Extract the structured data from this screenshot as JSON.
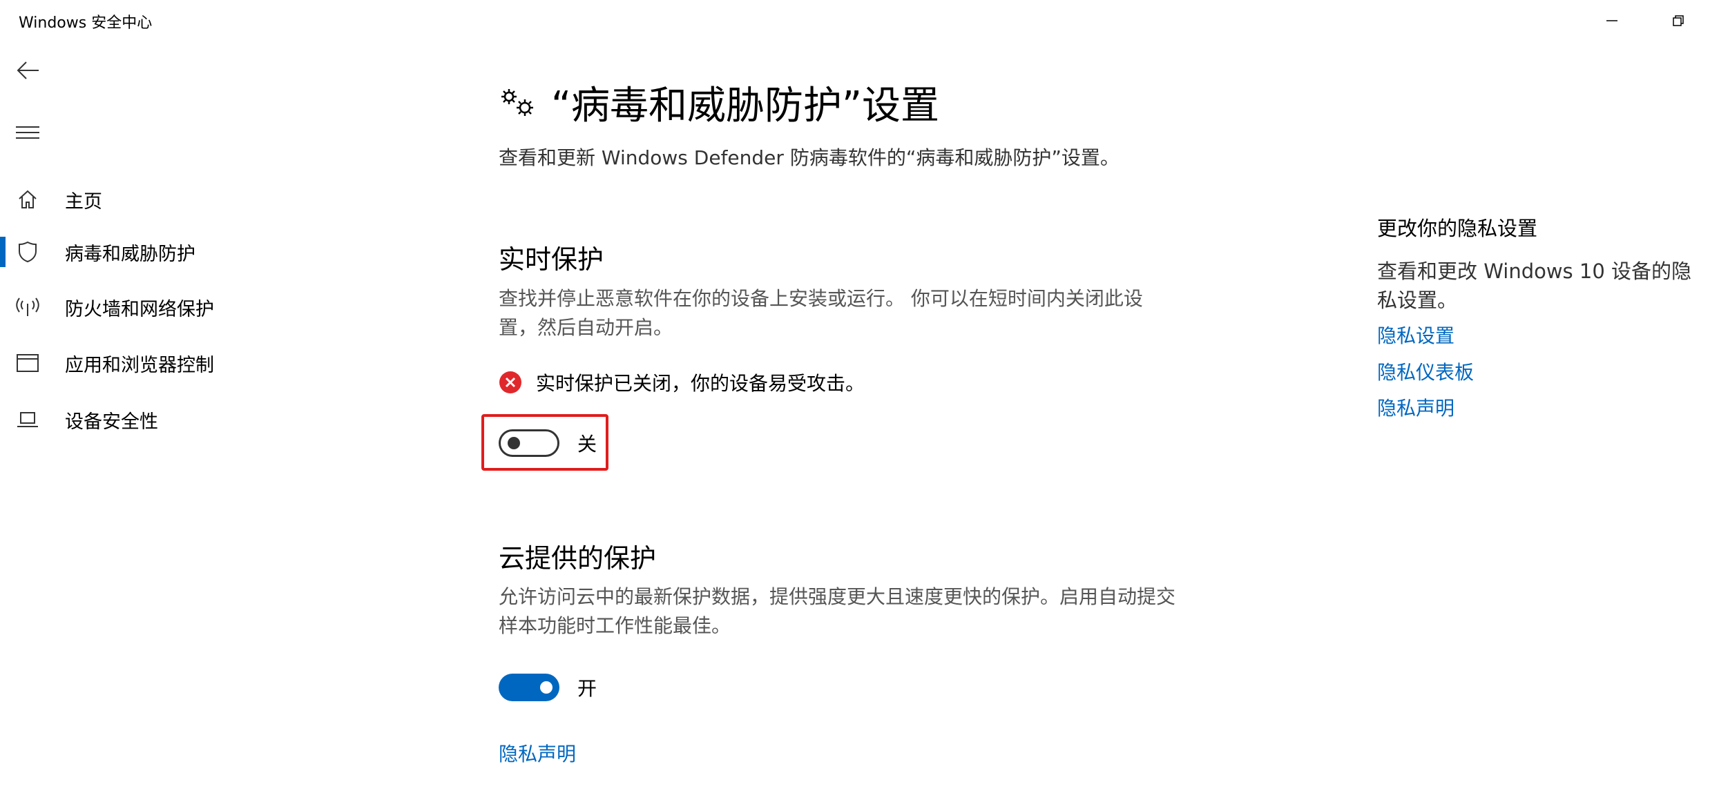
{
  "window": {
    "title": "Windows 安全中心"
  },
  "nav": {
    "items": [
      {
        "label": "主页",
        "icon": "home-icon"
      },
      {
        "label": "病毒和威胁防护",
        "icon": "shield-icon",
        "selected": true
      },
      {
        "label": "防火墙和网络保护",
        "icon": "wireless-antenna-icon"
      },
      {
        "label": "应用和浏览器控制",
        "icon": "app-window-icon"
      },
      {
        "label": "设备安全性",
        "icon": "laptop-icon"
      }
    ]
  },
  "header": {
    "title": "“病毒和威胁防护”设置",
    "description": "查看和更新 Windows Defender 防病毒软件的“病毒和威胁防护”设置。"
  },
  "realtime": {
    "title": "实时保护",
    "description": "查找并停止恶意软件在你的设备上安装或运行。 你可以在短时间内关闭此设置，然后自动开启。",
    "status": "实时保护已关闭，你的设备易受攻击。",
    "toggle_state": "关",
    "toggle_on": false
  },
  "cloud": {
    "title": "云提供的保护",
    "description": "允许访问云中的最新保护数据，提供强度更大且速度更快的保护。启用自动提交样本功能时工作性能最佳。",
    "toggle_state": "开",
    "toggle_on": true,
    "privacy_link": "隐私声明"
  },
  "aside": {
    "title": "更改你的隐私设置",
    "description": "查看和更改 Windows 10 设备的隐私设置。",
    "links": [
      "隐私设置",
      "隐私仪表板",
      "隐私声明"
    ]
  },
  "colors": {
    "accent": "#0067c0",
    "error": "#e0282c",
    "highlight": "#e11c1c"
  }
}
